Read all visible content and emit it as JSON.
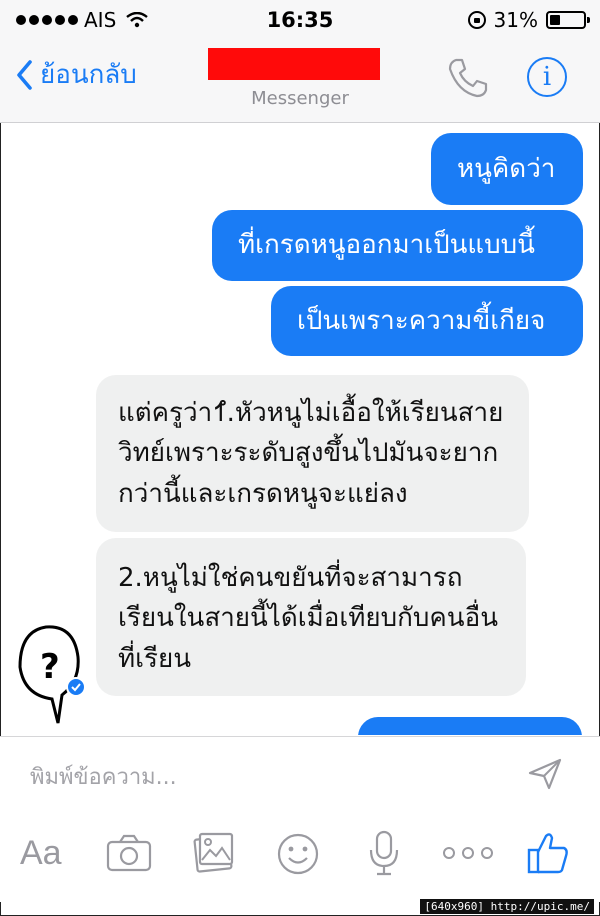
{
  "status_bar": {
    "carrier": "AIS",
    "time": "16:35",
    "battery": "31%"
  },
  "nav": {
    "back_label": "ย้อนกลับ",
    "subtitle": "Messenger"
  },
  "messages": {
    "out1": "หนูคิดว่า",
    "out2": "ที่เกรดหนูออกมาเป็นแบบนี้",
    "out3": "เป็นเพราะความขี้เกียจ",
    "in1": "แต่ครูว่า1ํ.หัวหนูไม่เอื้อให้เรียนสายวิทย์เพราะระดับสูงขึ้นไปมันจะยากกว่านี้และเกรดหนูจะแย่ลง",
    "in2": "2.หนูไม่ใช่คนขยันที่จะสามารถเรียนในสายนี้ได้เมื่อเทียบกับคนอื่นที่เรียน"
  },
  "composer": {
    "placeholder": "พิมพ์ข้อความ..."
  },
  "toolbar": {
    "aa_label": "Aa"
  },
  "watermark": "[640x960] http://upic.me/",
  "colors": {
    "accent": "#1a7cf5",
    "incoming_bubble": "#eff0f0",
    "redaction": "#ff0a0a"
  },
  "icons": [
    "wifi-icon",
    "battery-icon",
    "orientation-lock-icon",
    "back-chevron-icon",
    "phone-icon",
    "info-icon",
    "send-icon",
    "camera-icon",
    "photo-icon",
    "emoji-icon",
    "microphone-icon",
    "more-icon",
    "like-icon",
    "avatar-question-icon"
  ]
}
